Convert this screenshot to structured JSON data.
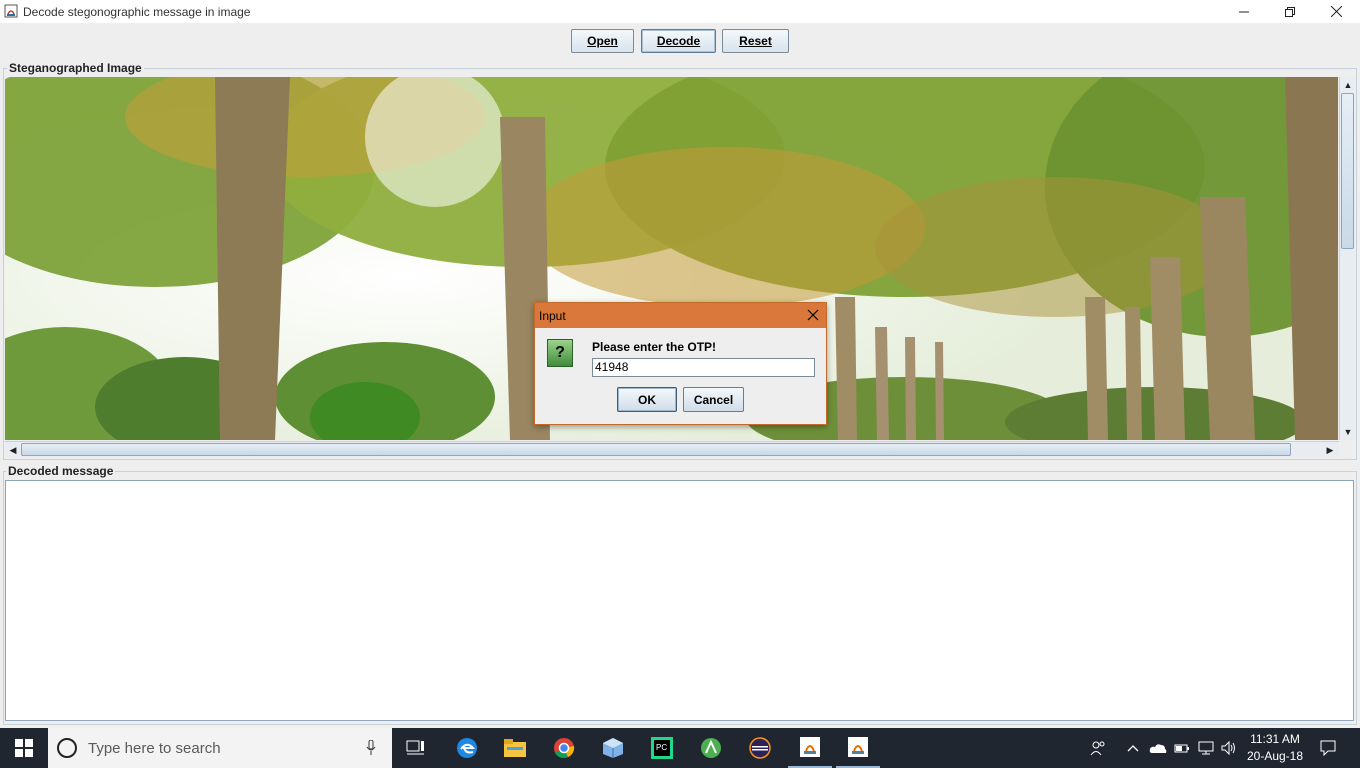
{
  "window": {
    "title": "Decode stegonographic message in image"
  },
  "toolbar": {
    "open_label": "Open",
    "decode_label": "Decode",
    "reset_label": "Reset"
  },
  "image_panel": {
    "label": "Steganographed Image"
  },
  "decoded_panel": {
    "label": "Decoded message",
    "value": ""
  },
  "dialog": {
    "title": "Input",
    "prompt": "Please enter the OTP!",
    "otp_value": "41948",
    "ok_label": "OK",
    "cancel_label": "Cancel",
    "icon_glyph": "?"
  },
  "taskbar": {
    "search_placeholder": "Type here to search",
    "apps": [
      "task-view",
      "edge",
      "file-explorer",
      "chrome",
      "virtualbox",
      "pycharm",
      "android-studio",
      "eclipse",
      "java",
      "java"
    ],
    "time": "11:31 AM",
    "date": "20-Aug-18"
  },
  "colors": {
    "dialog_title": "#d9783a",
    "taskbar": "#1f2630",
    "window_bg": "#eeeeee"
  }
}
